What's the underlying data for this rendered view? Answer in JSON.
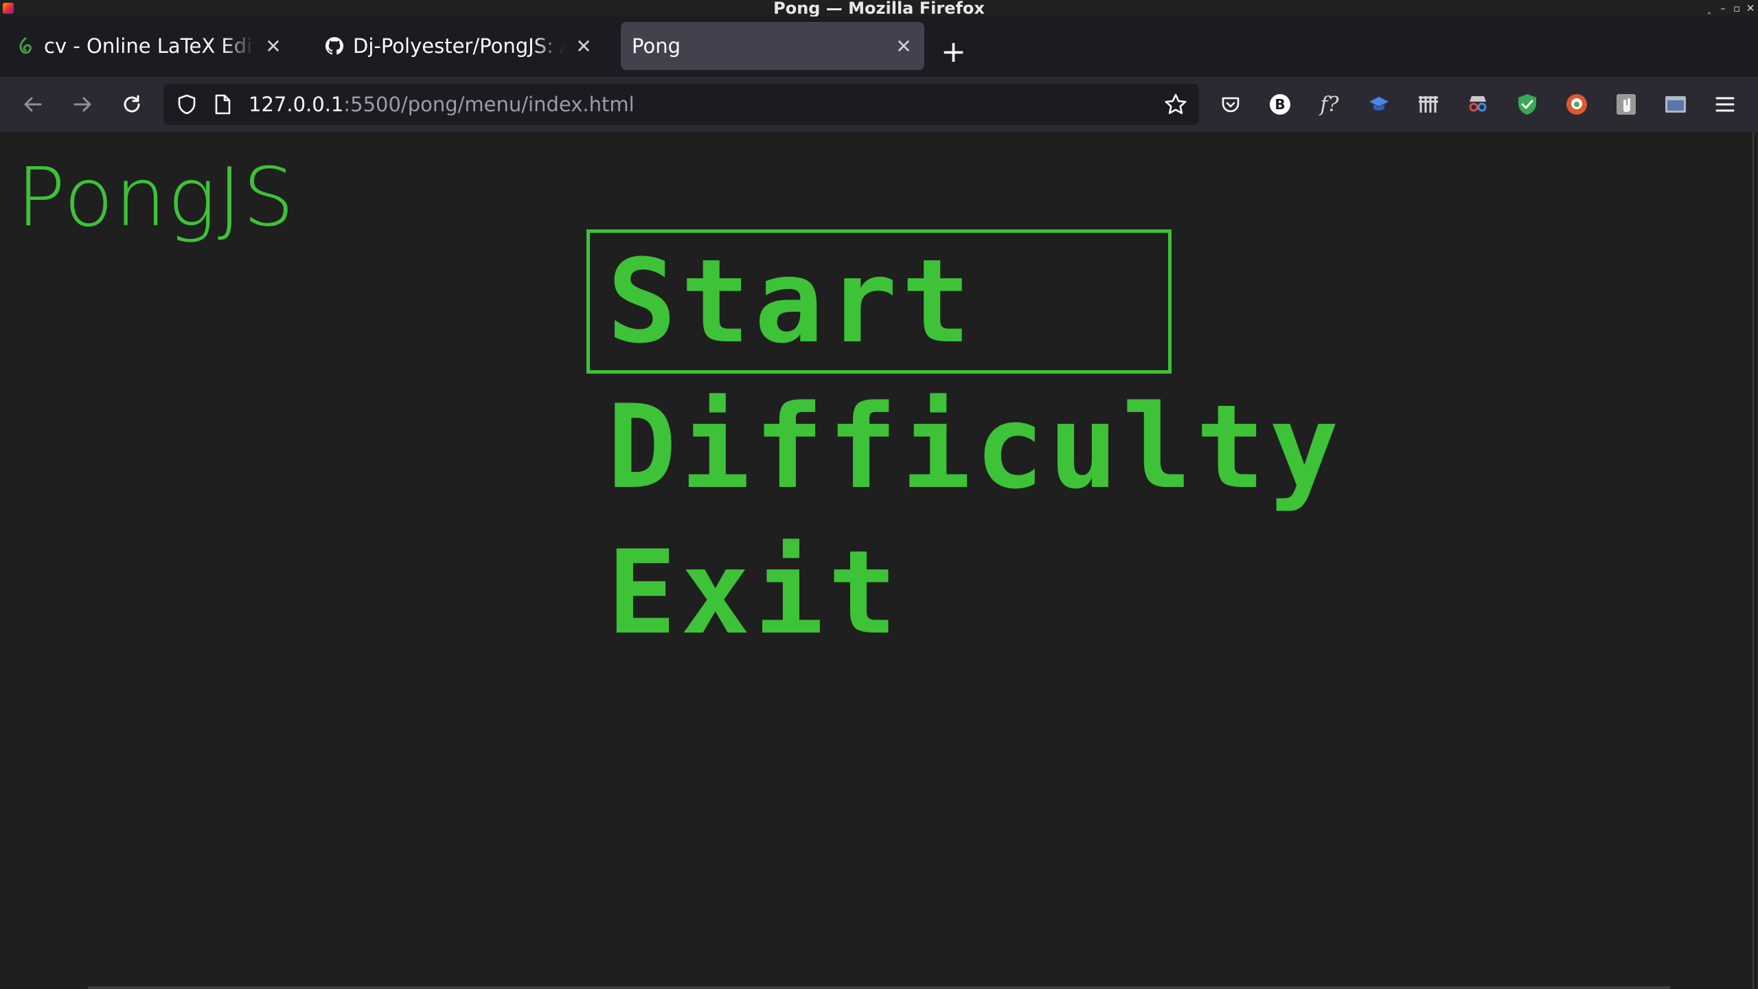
{
  "window": {
    "title": "Pong — Mozilla Firefox",
    "controls": {
      "minimize": "‸",
      "restore": "–",
      "maximize": "▫",
      "close": "✕"
    }
  },
  "tabs": [
    {
      "title": "cv - Online LaTeX Editor Overleaf",
      "favicon": "overleaf-leaf-icon",
      "active": false
    },
    {
      "title": "Dj-Polyester/PongJS: A Pong game",
      "favicon": "github-icon",
      "active": false
    },
    {
      "title": "Pong",
      "favicon": "",
      "active": true
    }
  ],
  "new_tab_label": "+",
  "navigation": {
    "url_host": "127.0.0.1",
    "url_path": ":5500/pong/menu/index.html"
  },
  "extensions": [
    "pocket-icon",
    "b-icon",
    "f?-icon",
    "graduation-cap-icon",
    "gate-icon",
    "spy-icon",
    "shield-check-icon",
    "duckduckgo-icon",
    "hand-icon",
    "window-icon",
    "hamburger-menu-icon"
  ],
  "extension_labels": {
    "b": "B",
    "f": "f?"
  },
  "page": {
    "logo": "PongJS",
    "menu": [
      {
        "label": "Start",
        "selected": true
      },
      {
        "label": "Difficulty",
        "selected": false
      },
      {
        "label": "Exit",
        "selected": false
      }
    ]
  },
  "colors": {
    "accent_green": "#3ec238",
    "page_background": "#1f1f1f",
    "toolbar": "#2b2a33",
    "tabstrip": "#1c1b22"
  }
}
